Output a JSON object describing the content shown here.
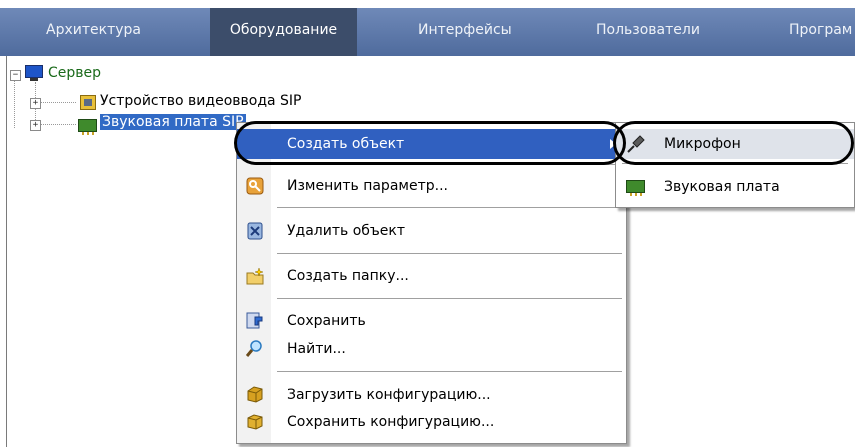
{
  "tabs": [
    {
      "label": "Архитектура",
      "active": false
    },
    {
      "label": "Оборудование",
      "active": true
    },
    {
      "label": "Интерфейсы",
      "active": false
    },
    {
      "label": "Пользователи",
      "active": false
    },
    {
      "label": "Програм",
      "active": false
    }
  ],
  "tree": {
    "root": {
      "label": "Сервер",
      "icon": "monitor-icon",
      "expander": "minus"
    },
    "children": [
      {
        "label": "Устройство видеоввода SIP",
        "icon": "video-input-chip-icon",
        "expander": "plus"
      },
      {
        "label": "Звуковая плата SIP",
        "icon": "sound-card-icon",
        "expander": "plus",
        "selected": true
      }
    ]
  },
  "context_menu": {
    "items": [
      {
        "label": "Создать объект",
        "icon": "",
        "has_submenu": true,
        "highlighted": true
      },
      {
        "label": "Изменить параметр...",
        "icon": "edit-key-icon"
      },
      {
        "label": "Удалить объект",
        "icon": "delete-icon"
      },
      {
        "label": "Создать папку...",
        "icon": "new-folder-icon"
      },
      {
        "label": "Сохранить",
        "icon": "save-icon"
      },
      {
        "label": "Найти...",
        "icon": "search-icon"
      },
      {
        "label": "Загрузить конфигурацию...",
        "icon": "load-config-icon"
      },
      {
        "label": "Сохранить конфигурацию...",
        "icon": "save-config-icon"
      }
    ]
  },
  "submenu": {
    "items": [
      {
        "label": "Микрофон",
        "icon": "microphone-icon",
        "highlighted": true
      },
      {
        "label": "Звуковая плата",
        "icon": "sound-card-icon"
      }
    ]
  },
  "colors": {
    "tabbar": "#5c77a8",
    "active_tab": "#3c4d6a",
    "menu_highlight": "#3060c0",
    "selection": "#316ac5",
    "tree_root_text": "#1a6a1a"
  }
}
